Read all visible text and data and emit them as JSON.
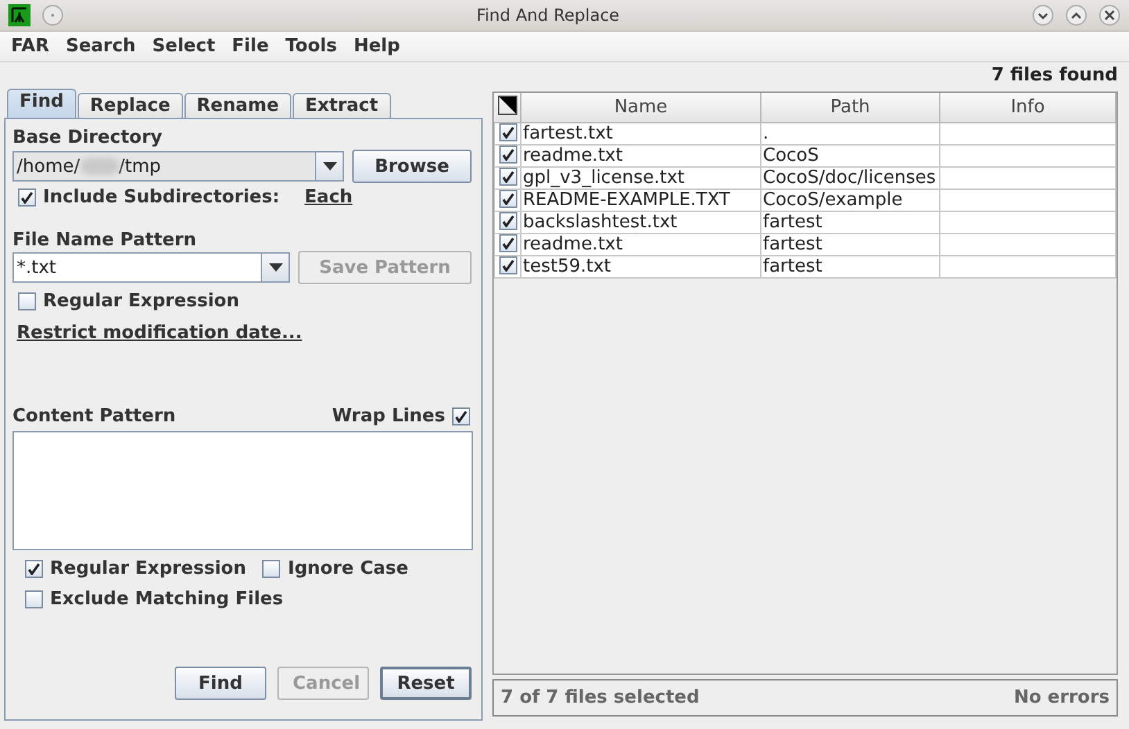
{
  "window": {
    "title": "Find And Replace"
  },
  "menu": [
    {
      "label": "FAR"
    },
    {
      "label": "Search"
    },
    {
      "label": "Select"
    },
    {
      "label": "File"
    },
    {
      "label": "Tools"
    },
    {
      "label": "Help"
    }
  ],
  "tabs": [
    {
      "label": "Find",
      "selected": true
    },
    {
      "label": "Replace",
      "selected": false
    },
    {
      "label": "Rename",
      "selected": false
    },
    {
      "label": "Extract",
      "selected": false
    }
  ],
  "base_directory": {
    "label": "Base Directory",
    "value_start": "/home/",
    "value_end": "/tmp",
    "redacted": true,
    "browse": "Browse",
    "include_subdirectories": {
      "label": "Include Subdirectories:",
      "checked": true
    },
    "each_link": "Each"
  },
  "file_name_pattern": {
    "label": "File Name Pattern",
    "value": "*.txt",
    "save_pattern": {
      "label": "Save Pattern",
      "disabled": true
    },
    "regular_expression": {
      "label": "Regular Expression",
      "checked": false
    },
    "restrict_link": "Restrict modification date..."
  },
  "content_pattern": {
    "label": "Content Pattern",
    "wrap_lines": {
      "label": "Wrap Lines",
      "checked": true
    },
    "options": [
      {
        "label": "Regular Expression",
        "checked": true
      },
      {
        "label": "Ignore Case",
        "checked": false
      },
      {
        "label": "Exclude Matching Files",
        "checked": false
      }
    ]
  },
  "buttons": [
    {
      "label": "Find",
      "disabled": false,
      "selected": false
    },
    {
      "label": "Cancel",
      "disabled": true,
      "selected": false
    },
    {
      "label": "Reset",
      "disabled": false,
      "selected": true
    }
  ],
  "results": {
    "summary": "7 files found",
    "columns": [
      "Name",
      "Path",
      "Info"
    ],
    "rows": [
      {
        "name": "fartest.txt",
        "path": ".",
        "checked": true
      },
      {
        "name": "readme.txt",
        "path": "CocoS",
        "checked": true
      },
      {
        "name": "gpl_v3_license.txt",
        "path": "CocoS/doc/licenses",
        "checked": true
      },
      {
        "name": "README-EXAMPLE.TXT",
        "path": "CocoS/example",
        "checked": true
      },
      {
        "name": "backslashtest.txt",
        "path": "fartest",
        "checked": true
      },
      {
        "name": "readme.txt",
        "path": "fartest",
        "checked": true
      },
      {
        "name": "test59.txt",
        "path": "fartest",
        "checked": true
      }
    ]
  },
  "status_bar": {
    "selection": "7 of 7 files selected",
    "errors": "No errors"
  }
}
